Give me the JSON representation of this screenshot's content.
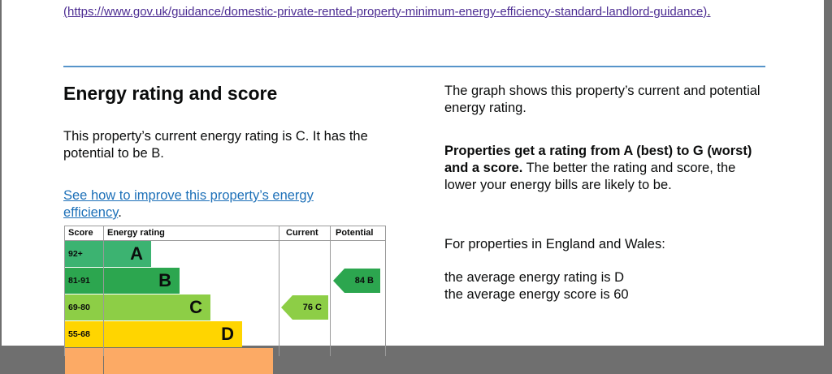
{
  "top_link": {
    "url_text": "(https://www.gov.uk/guidance/domestic-private-rented-property-minimum-energy-efficiency-standard-landlord-guidance)",
    "tail": "."
  },
  "section": {
    "title": "Energy rating and score",
    "rating_text": "This property’s current energy rating is C. It has the potential to be B.",
    "improve_link": "See how to improve this property’s energy efficiency",
    "improve_tail": "."
  },
  "right": {
    "p1": "The graph shows this property’s current and potential energy rating.",
    "p2_bold": "Properties get a rating from A (best) to G (worst) and a score.",
    "p2_rest": " The better the rating and score, the lower your energy bills are likely to be.",
    "p3": "For properties in England and Wales:",
    "p4_line1": "the average energy rating is D",
    "p4_line2": "the average energy score is 60"
  },
  "chart_data": {
    "type": "table",
    "headers": [
      "Score",
      "Energy rating",
      "Current",
      "Potential"
    ],
    "bands": [
      {
        "score": "92+",
        "letter": "A",
        "color": "#3cb371",
        "fill": 0.18
      },
      {
        "score": "81-91",
        "letter": "B",
        "color": "#2ca64f",
        "fill": 0.29
      },
      {
        "score": "69-80",
        "letter": "C",
        "color": "#8dce46",
        "fill": 0.41
      },
      {
        "score": "55-68",
        "letter": "D",
        "color": "#ffd500",
        "fill": 0.53
      },
      {
        "score": "",
        "letter": "",
        "color": "#fcaa65",
        "fill": 0.65
      }
    ],
    "current": {
      "label": "76 C",
      "band": "C",
      "color": "#8dce46"
    },
    "potential": {
      "label": "84 B",
      "band": "B",
      "color": "#2ca64f"
    }
  }
}
